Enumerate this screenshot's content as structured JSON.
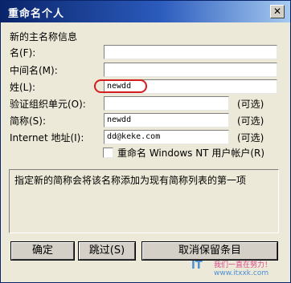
{
  "window": {
    "title": "重命名个人",
    "close_glyph": "✕"
  },
  "section_label": "新的主名称信息",
  "fields": {
    "first_name": {
      "label": "名(F):",
      "value": ""
    },
    "middle_name": {
      "label": "中间名(M):",
      "value": ""
    },
    "last_name": {
      "label": "姓(L):",
      "value": "newdd"
    },
    "org_unit": {
      "label": "验证组织单元(O):",
      "value": "",
      "optional": "(可选)"
    },
    "short_name": {
      "label": "简称(S):",
      "value": "newdd",
      "optional": "(可选)"
    },
    "internet_address": {
      "label": "Internet 地址(I):",
      "value": "dd@keke.com",
      "optional": "(可选)"
    }
  },
  "rename_nt_checkbox": {
    "label": "重命名 Windows NT 用户帐户(R)",
    "checked": false
  },
  "info_text": "指定新的简称会将该名称添加为现有简称列表的第一项",
  "buttons": {
    "ok": "确定",
    "skip": "跳过(S)",
    "cancel_keep": "取消保留条目"
  },
  "watermark": {
    "logo": "IT",
    "line1": "我们一直在努力！",
    "line2": "www.itxxk.com"
  },
  "colors": {
    "dialog_bg": "#ece9d8",
    "title_bar": "#0a246a",
    "highlight_ring": "#d21e1e"
  }
}
